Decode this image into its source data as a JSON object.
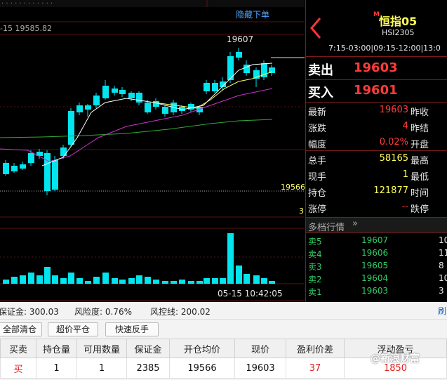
{
  "chart": {
    "hide_order_label": "隐藏下单",
    "top_left_label": "-15 19585.82",
    "high_label": "19607",
    "right_level_label": "19566",
    "right_level_label_small": "3",
    "time_label": "05-15 10:42:05",
    "toolbar_glyphs": "· · · · · · · · · · · ·"
  },
  "instrument": {
    "back_icon": "chevron-left-icon",
    "badge": "M",
    "name": "恒指05",
    "code": "HSI2305",
    "sessions": "7:15-03:00|09:15-12:00|13:0"
  },
  "bid_ask": {
    "sell_label": "卖出",
    "sell_value": "19603",
    "buy_label": "买入",
    "buy_value": "19601"
  },
  "quote_rows": [
    {
      "label": "最新",
      "value": "19603",
      "label2": "昨收"
    },
    {
      "label": "涨跌",
      "value": "4",
      "label2": "昨结"
    },
    {
      "label": "幅度",
      "value": "0.02%",
      "label2": "开盘"
    },
    {
      "label": "总手",
      "value": "58165",
      "label2": "最高"
    },
    {
      "label": "现手",
      "value": "1",
      "label2": "最低"
    },
    {
      "label": "持仓",
      "value": "121877",
      "label2": "时间"
    },
    {
      "label": "涨停",
      "value": "--",
      "label2": "跌停"
    }
  ],
  "depth": {
    "title": "多档行情",
    "rows": [
      {
        "label": "卖5",
        "price": "19607",
        "vol": "10"
      },
      {
        "label": "卖4",
        "price": "19606",
        "vol": "11"
      },
      {
        "label": "卖3",
        "price": "19605",
        "vol": "8"
      },
      {
        "label": "卖2",
        "price": "19604",
        "vol": "10"
      },
      {
        "label": "卖1",
        "price": "19603",
        "vol": "3"
      }
    ]
  },
  "account": {
    "margin_label": "保证金: 300.03",
    "risk_label": "风险度: 0.76%",
    "control_label": "风控线: 200.02",
    "refresh_label": "刷"
  },
  "buttons": {
    "close_all": "全部清仓",
    "quick_flat": "超价平仓",
    "quick_reverse": "快速反手"
  },
  "positions": {
    "headers": [
      "买卖",
      "持仓量",
      "可用数量",
      "保证金",
      "开仓均价",
      "现价",
      "盈利价差",
      "浮动盈亏"
    ],
    "rows": [
      [
        "买",
        "1",
        "1",
        "2385",
        "19566",
        "19603",
        "37",
        "1850"
      ]
    ]
  },
  "watermark": "@新浪财富",
  "colors": {
    "up": "#ff3b3b",
    "down": "#00e5ee",
    "ma_white": "#ffffff",
    "ma_yellow": "#ffff66",
    "ma_magenta": "#cc33cc",
    "ma_green": "#33aa33"
  }
}
